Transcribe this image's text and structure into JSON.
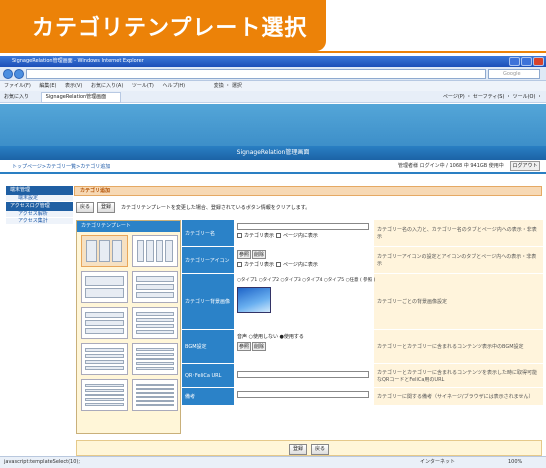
{
  "banner": {
    "title": "カテゴリテンプレート選択"
  },
  "window": {
    "title": "SignageRelation管理画面 - Windows Internet Explorer",
    "search_placeholder": "Google",
    "menu": [
      "ファイル(F)",
      "編集(E)",
      "表示(V)",
      "お気に入り(A)",
      "ツール(T)",
      "ヘルプ(H)"
    ],
    "menu_right": "変換 ・ 選択",
    "favorites": "お気に入り",
    "tab": "SignageRelation管理画面",
    "toolbar_right": "ページ(P) ・ セーフティ(S) ・ ツール(O) ・"
  },
  "page": {
    "header": "SignageRelation管理画面",
    "breadcrumb": "トップページ>カテゴリ一覧>カテゴリ追加",
    "login": "管理者様 ログイン中 / 1068 中 941GB 使用中",
    "logout": "ログアウト",
    "sidebar": [
      {
        "heading": "端末管理",
        "items": [
          "端末設定"
        ]
      },
      {
        "heading": "アクセスログ管理",
        "items": [
          "アクセス解析",
          "アクセス集計"
        ]
      }
    ],
    "main_title": "カテゴリ追加",
    "btn_back": "戻る",
    "btn_register": "登録",
    "note": "カテゴリテンプレートを変更した場合、登録されているボタン情報をクリアします。",
    "tpl_heading": "カテゴリテンプレート",
    "form": {
      "name": {
        "label": "カテゴリー名",
        "chk1": "カテゴリ表示",
        "chk2": "ページ内に表示",
        "desc": "カテゴリー名の入力と、カテゴリー名のタブとページ内への表示・非表示"
      },
      "icon": {
        "label": "カテゴリーアイコン",
        "btn1": "参照",
        "btn2": "削除",
        "chk1": "カテゴリ表示",
        "chk2": "ページ内に表示",
        "desc": "カテゴリーアイコンの設定とアイコンのタブとページ内への表示・非表示"
      },
      "bg": {
        "label": "カテゴリー背景画像",
        "types": "○タイプ1 ○タイプ2 ○タイプ3 ○タイプ4 ○タイプ5 ○任意 ( 参照 )",
        "desc": "カテゴリーごとの背景画像設定"
      },
      "bgm": {
        "label": "BGM設定",
        "opts": "音声 ○使用しない ●使用する",
        "btn1": "参照",
        "btn2": "削除",
        "desc": "カテゴリーとカテゴリーに含まれるコンテンツ表示中のBGM設定"
      },
      "qr": {
        "label": "QR･FeliCa URL",
        "desc": "カテゴリーとカテゴリーに含まれるコンテンツを表示した時に取得可能なQRコードとFeliCa用のURL"
      },
      "memo": {
        "label": "備考",
        "desc": "カテゴリーに関する備考（サイネージ/ブラウザには表示されません）"
      }
    }
  },
  "status": {
    "left": "javascript:templateSelect(10);",
    "zone": "インターネット",
    "zoom": "100%"
  }
}
